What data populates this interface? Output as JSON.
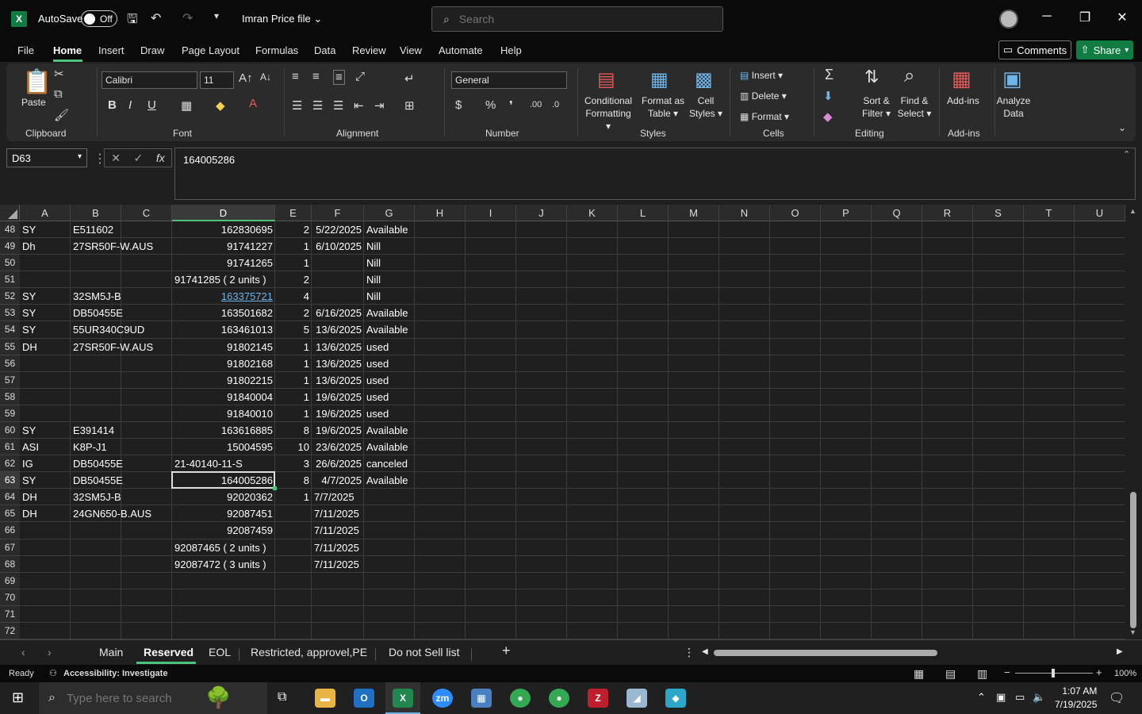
{
  "titlebar": {
    "autosave_label": "AutoSave",
    "autosave_state": "Off",
    "filename": "Imran Price file",
    "search_placeholder": "Search"
  },
  "menu": [
    "File",
    "Home",
    "Insert",
    "Draw",
    "Page Layout",
    "Formulas",
    "Data",
    "Review",
    "View",
    "Automate",
    "Help"
  ],
  "actions": {
    "comments": "Comments",
    "share": "Share"
  },
  "ribbon": {
    "clipboard": {
      "paste": "Paste",
      "label": "Clipboard"
    },
    "font": {
      "name": "Calibri",
      "size": "11",
      "label": "Font"
    },
    "alignment": {
      "label": "Alignment"
    },
    "number": {
      "format": "General",
      "label": "Number"
    },
    "styles": {
      "conditional": "Conditional",
      "formatting": "Formatting",
      "format_as": "Format as",
      "table": "Table",
      "cell": "Cell",
      "styles": "Styles",
      "label": "Styles"
    },
    "cells": {
      "insert": "Insert",
      "delete": "Delete",
      "format": "Format",
      "label": "Cells"
    },
    "editing": {
      "sort": "Sort &",
      "filter": "Filter",
      "find": "Find &",
      "select": "Select",
      "label": "Editing"
    },
    "addins": {
      "addins": "Add-ins",
      "label": "Add-ins",
      "analyze": "Analyze",
      "data": "Data"
    }
  },
  "formula": {
    "namebox": "D63",
    "value": "164005286"
  },
  "columns": [
    "A",
    "B",
    "C",
    "D",
    "E",
    "F",
    "G",
    "H",
    "I",
    "J",
    "K",
    "L",
    "M",
    "N",
    "O",
    "P",
    "Q",
    "R",
    "S",
    "T",
    "U"
  ],
  "rows": [
    {
      "n": "48",
      "a": "SY",
      "b": "E511602",
      "d": "162830695",
      "e": "2",
      "f": "5/22/2025",
      "g": "Available"
    },
    {
      "n": "49",
      "a": "Dh",
      "b": "27SR50F-W.AUS",
      "d": "91741227",
      "e": "1",
      "f": "6/10/2025",
      "g": "Nill"
    },
    {
      "n": "50",
      "a": "",
      "b": "",
      "d": "91741265",
      "e": "1",
      "f": "",
      "g": "Nill"
    },
    {
      "n": "51",
      "a": "",
      "b": "",
      "d": "91741285 ( 2 units )",
      "e": "2",
      "f": "",
      "g": "Nill"
    },
    {
      "n": "52",
      "a": "SY",
      "b": "32SM5J-B",
      "d": "163375721",
      "e": "4",
      "f": "",
      "g": "Nill"
    },
    {
      "n": "53",
      "a": "SY",
      "b": "DB50455E",
      "d": "163501682",
      "e": "2",
      "f": "6/16/2025",
      "g": "Available"
    },
    {
      "n": "54",
      "a": "SY",
      "b": "55UR340C9UD",
      "d": "163461013",
      "e": "5",
      "f": "13/6/2025",
      "g": "Available"
    },
    {
      "n": "55",
      "a": "DH",
      "b": " 27SR50F-W.AUS",
      "d": "91802145",
      "e": "1",
      "f": "13/6/2025",
      "g": "used"
    },
    {
      "n": "56",
      "a": "",
      "b": "",
      "d": "91802168",
      "e": "1",
      "f": "13/6/2025",
      "g": "used"
    },
    {
      "n": "57",
      "a": "",
      "b": "",
      "d": "91802215",
      "e": "1",
      "f": "13/6/2025",
      "g": "used"
    },
    {
      "n": "58",
      "a": "",
      "b": "",
      "d": "91840004",
      "e": "1",
      "f": "19/6/2025",
      "g": "used"
    },
    {
      "n": "59",
      "a": "",
      "b": "",
      "d": "91840010",
      "e": "1",
      "f": "19/6/2025",
      "g": "used"
    },
    {
      "n": "60",
      "a": "SY",
      "b": "E391414",
      "d": "163616885",
      "e": "8",
      "f": "19/6/2025",
      "g": "Available"
    },
    {
      "n": "61",
      "a": "ASI",
      "b": "K8P-J1",
      "d": "15004595",
      "e": "10",
      "f": "23/6/2025",
      "g": "Available"
    },
    {
      "n": "62",
      "a": "IG",
      "b": "DB50455E",
      "d": "21-40140-11-S",
      "e": "3",
      "f": "26/6/2025",
      "g": "canceled"
    },
    {
      "n": "63",
      "a": "SY",
      "b": "DB50455E",
      "d": "164005286",
      "e": "8",
      "f": "4/7/2025",
      "g": "Available"
    },
    {
      "n": "64",
      "a": "DH",
      "b": "32SM5J-B",
      "d": "92020362",
      "e": "1",
      "f": "7/7/2025",
      "g": ""
    },
    {
      "n": "65",
      "a": "DH",
      "b": "24GN650-B.AUS",
      "d": "92087451",
      "e": "",
      "f": "7/11/2025",
      "g": ""
    },
    {
      "n": "66",
      "a": "",
      "b": "",
      "d": "92087459",
      "e": "",
      "f": "7/11/2025",
      "g": ""
    },
    {
      "n": "67",
      "a": "",
      "b": "",
      "d": "92087465 ( 2 units )",
      "e": "",
      "f": "7/11/2025",
      "g": ""
    },
    {
      "n": "68",
      "a": "",
      "b": "",
      "d": "92087472 ( 3 units )",
      "e": "",
      "f": "7/11/2025",
      "g": ""
    },
    {
      "n": "69",
      "a": "",
      "b": "",
      "d": "",
      "e": "",
      "f": "",
      "g": ""
    },
    {
      "n": "70",
      "a": "",
      "b": "",
      "d": "",
      "e": "",
      "f": "",
      "g": ""
    },
    {
      "n": "71",
      "a": "",
      "b": "",
      "d": "",
      "e": "",
      "f": "",
      "g": ""
    },
    {
      "n": "72",
      "a": "",
      "b": "",
      "d": "",
      "e": "",
      "f": "",
      "g": ""
    }
  ],
  "sheets": [
    "Main",
    "Reserved",
    "EOL",
    "Restricted, approvel,PE",
    "Do not Sell list"
  ],
  "status": {
    "ready": "Ready",
    "accessibility": "Accessibility: Investigate",
    "zoom": "100%"
  },
  "taskbar": {
    "search_placeholder": "Type here to search",
    "time": "1:07 AM",
    "date": "7/19/2025"
  },
  "colors": {
    "accent": "#107c41",
    "highlight": "#4ec27a",
    "link": "#6fb4e8"
  }
}
